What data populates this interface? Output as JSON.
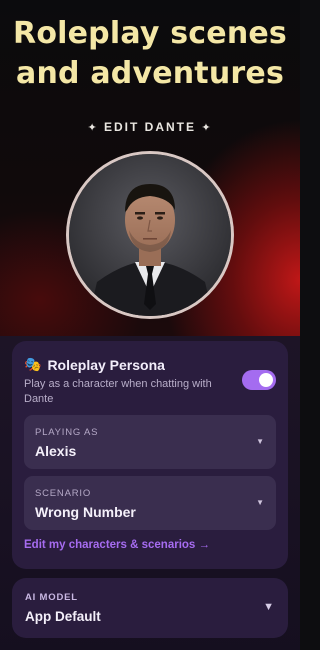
{
  "hero": {
    "headline_line1": "Roleplay scenes",
    "headline_line2": "and adventures",
    "edit_label": "EDIT DANTE",
    "spark_left": "✦",
    "spark_right": "✦",
    "avatar_alt": "Dante portrait"
  },
  "persona": {
    "icon": "🎭",
    "icon_name": "theater-masks-icon",
    "title": "Roleplay Persona",
    "description": "Play as a character when chatting with Dante",
    "toggle_on": true,
    "accent_color": "#a46cf0",
    "playing_as": {
      "label": "PLAYING AS",
      "value": "Alexis"
    },
    "scenario": {
      "label": "SCENARIO",
      "value": "Wrong Number"
    },
    "edit_link": "Edit my characters & scenarios →"
  },
  "ai_model": {
    "label": "AI MODEL",
    "value": "App Default"
  }
}
